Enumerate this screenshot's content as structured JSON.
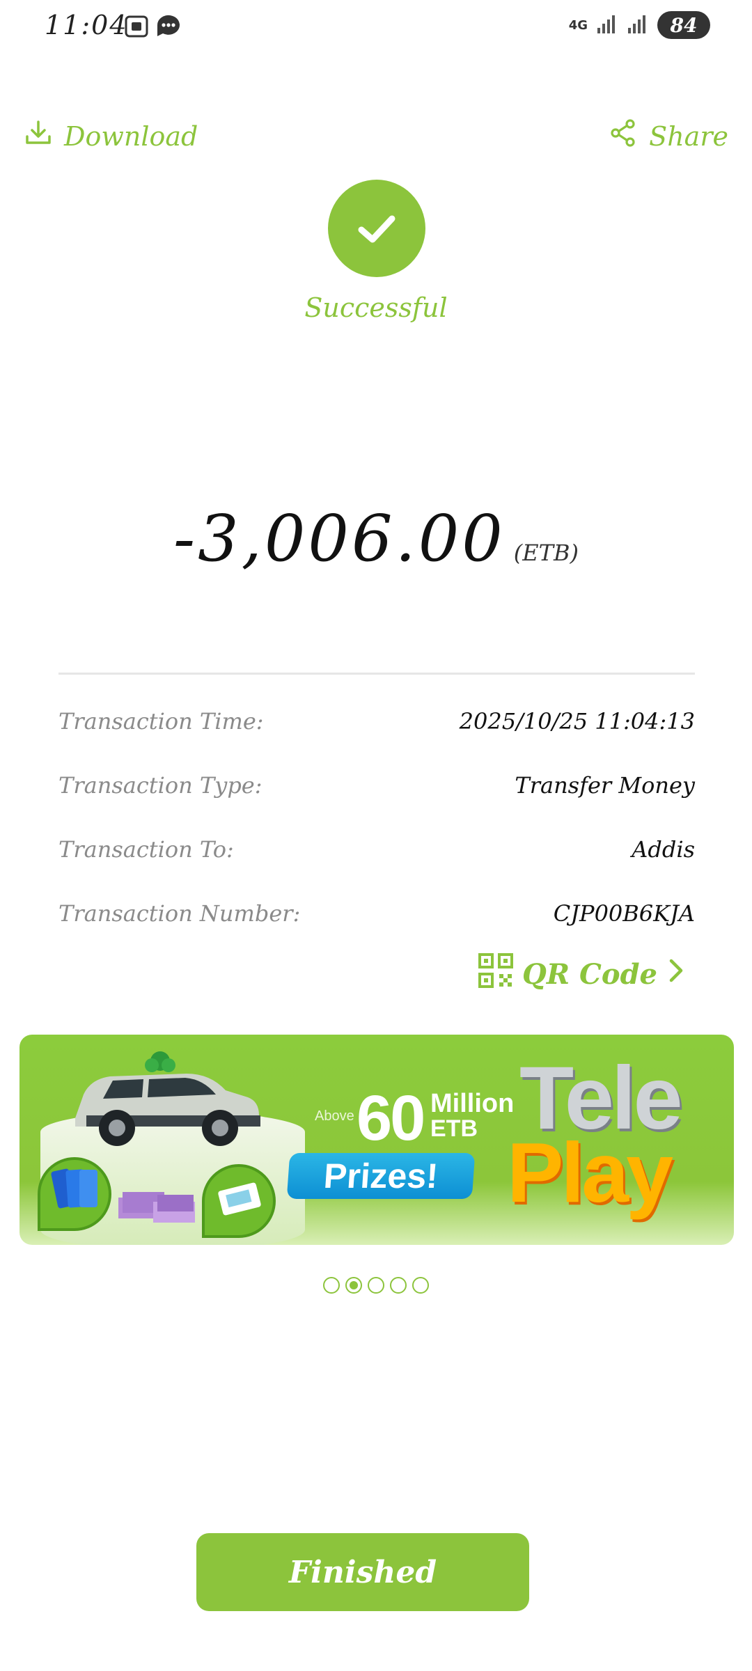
{
  "status_bar": {
    "time": "11:04",
    "network": "4G",
    "battery": "84",
    "icons": [
      "screenshot-icon",
      "message-icon",
      "signal-icon",
      "signal-icon",
      "battery-icon"
    ]
  },
  "header": {
    "download_label": "Download",
    "share_label": "Share"
  },
  "result": {
    "status_text": "Successful",
    "amount": "-3,006.00",
    "currency": "(ETB)"
  },
  "details": [
    {
      "label": "Transaction Time:",
      "value": "2025/10/25 11:04:13"
    },
    {
      "label": "Transaction Type:",
      "value": "Transfer Money"
    },
    {
      "label": "Transaction To:",
      "value": "Addis"
    },
    {
      "label": "Transaction Number:",
      "value": "CJP00B6KJA"
    }
  ],
  "qr_link_label": "QR Code",
  "banner": {
    "above": "Above",
    "amount": "60",
    "million": "Million",
    "currency": "ETB",
    "prizes": "Prizes!",
    "brand_line1": "Tele",
    "brand_line2": "Play"
  },
  "carousel": {
    "count": 5,
    "active_index": 1
  },
  "finish_button_label": "Finished",
  "colors": {
    "accent": "#8cc43c",
    "label_gray": "#8a8a8a"
  }
}
